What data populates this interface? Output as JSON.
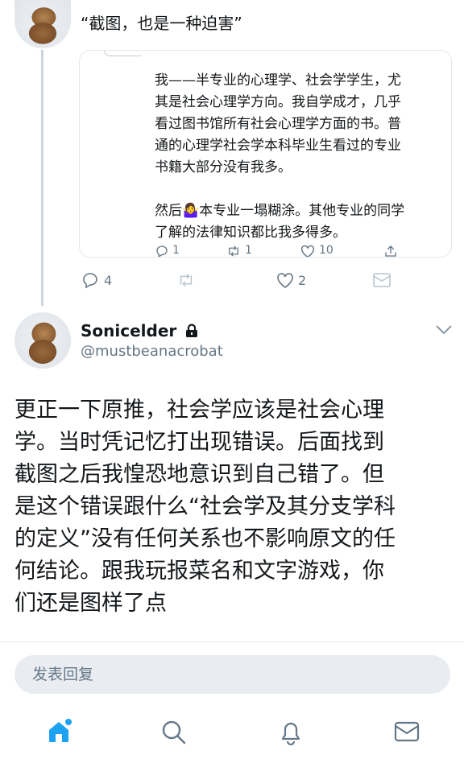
{
  "top_tweet": {
    "text": "“截图，也是一种迫害”",
    "quoted": {
      "lines": [
        "我——半专业的心理学、社会学学生，尤",
        "其是社会心理学方向。我自学成才，几乎",
        "看过图书馆所有社会心理学方面的书。普",
        "通的心理学社会学本科毕业生看过的专业",
        "书籍大部分没有我多。",
        "",
        "然后🤷‍♀️本专业一塌糊涂。其他专业的同学",
        "了解的法律知识都比我多得多。"
      ],
      "reply_count": "1",
      "retweet_count": "1",
      "like_count": "10"
    },
    "reply_count": "4",
    "like_count": "2"
  },
  "main_tweet": {
    "display_name": "Sonicelder",
    "handle": "@mustbeanacrobat",
    "text_lines": [
      "更正一下原推，社会学应该是社会心理",
      "学。当时凭记忆打出现错误。后面找到",
      "截图之后我惶恐地意识到自己错了。但",
      "是这个错误跟什么“社会学及其分支学科",
      "的定义”没有任何关系也不影响原文的任",
      "何结论。跟我玩报菜名和文字游戏，你",
      "们还是图样了点"
    ]
  },
  "reply_box": {
    "placeholder": "发表回复"
  },
  "colors": {
    "accent": "#1da1f2",
    "muted": "#657786",
    "border": "#e1e8ed"
  }
}
